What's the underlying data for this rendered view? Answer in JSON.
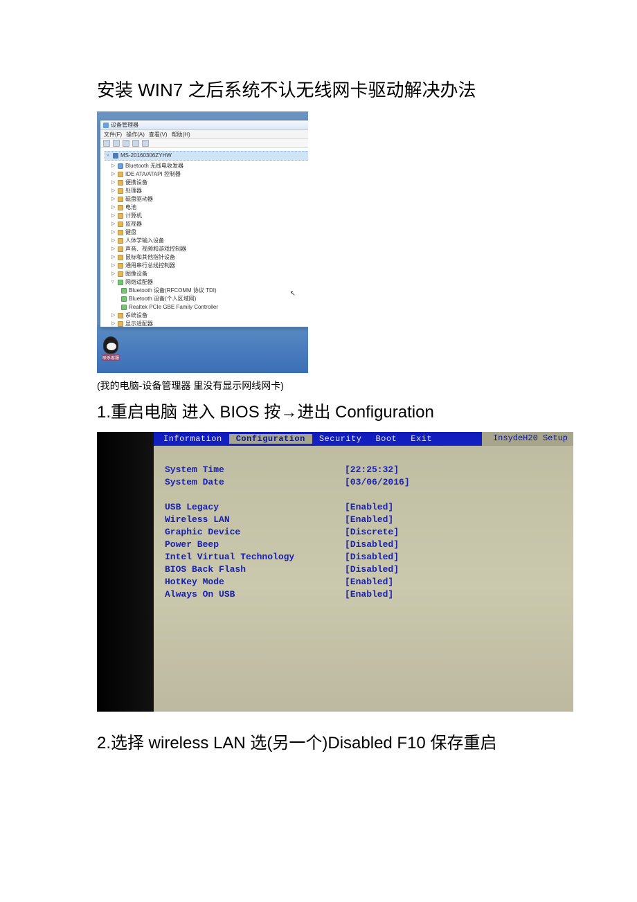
{
  "title": "安装 WIN7 之后系统不认无线网卡驱动解决办法",
  "deviceManager": {
    "windowTitle": "设备管理器",
    "menu": [
      "文件(F)",
      "操作(A)",
      "查看(V)",
      "帮助(H)"
    ],
    "root": "MS-20160306ZYHW",
    "nodes": [
      {
        "label": "Bluetooth 无线电收发器",
        "icon": "bt",
        "twisty": "▷"
      },
      {
        "label": "IDE ATA/ATAPI 控制器",
        "icon": "dev",
        "twisty": "▷"
      },
      {
        "label": "便携设备",
        "icon": "dev",
        "twisty": "▷"
      },
      {
        "label": "处理器",
        "icon": "dev",
        "twisty": "▷"
      },
      {
        "label": "磁盘驱动器",
        "icon": "dev",
        "twisty": "▷"
      },
      {
        "label": "电池",
        "icon": "dev",
        "twisty": "▷"
      },
      {
        "label": "计算机",
        "icon": "dev",
        "twisty": "▷"
      },
      {
        "label": "监视器",
        "icon": "dev",
        "twisty": "▷"
      },
      {
        "label": "键盘",
        "icon": "dev",
        "twisty": "▷"
      },
      {
        "label": "人体学输入设备",
        "icon": "dev",
        "twisty": "▷"
      },
      {
        "label": "声音、视频和游戏控制器",
        "icon": "dev",
        "twisty": "▷"
      },
      {
        "label": "鼠标和其他指针设备",
        "icon": "dev",
        "twisty": "▷"
      },
      {
        "label": "通用串行总线控制器",
        "icon": "dev",
        "twisty": "▷"
      },
      {
        "label": "图像设备",
        "icon": "dev",
        "twisty": "▷"
      },
      {
        "label": "网络适配器",
        "icon": "net",
        "twisty": "▿",
        "children": [
          {
            "label": "Bluetooth 设备(RFCOMM 协议 TDI)"
          },
          {
            "label": "Bluetooth 设备(个人区域网)"
          },
          {
            "label": "Realtek PCIe GBE Family Controller"
          }
        ]
      },
      {
        "label": "系统设备",
        "icon": "dev",
        "twisty": "▷"
      },
      {
        "label": "显示适配器",
        "icon": "dev",
        "twisty": "▷"
      }
    ],
    "qqLabel": "联系客服"
  },
  "caption": "(我的电脑-设备管理器  里没有显示网线网卡)",
  "step1": "1.重启电脑  进入 BIOS 按→进出 Configuration",
  "bios": {
    "brand": "InsydeH20 Setup",
    "tabs": [
      "Information",
      "Configuration",
      "Security",
      "Boot",
      "Exit"
    ],
    "selectedTab": "Configuration",
    "rows": [
      {
        "label": "System Time",
        "value": "[22:25:32]"
      },
      {
        "label": "System Date",
        "value": "[03/06/2016]"
      }
    ],
    "rows2": [
      {
        "label": "USB Legacy",
        "value": "[Enabled]"
      },
      {
        "label": "Wireless LAN",
        "value": "[Enabled]"
      },
      {
        "label": "Graphic Device",
        "value": "[Discrete]"
      },
      {
        "label": "Power Beep",
        "value": "[Disabled]"
      },
      {
        "label": "Intel Virtual Technology",
        "value": "[Disabled]"
      },
      {
        "label": "BIOS Back Flash",
        "value": "[Disabled]"
      },
      {
        "label": "HotKey Mode",
        "value": "[Enabled]"
      },
      {
        "label": "Always On USB",
        "value": "[Enabled]"
      }
    ]
  },
  "step2": "2.选择 wireless LAN  选(另一个)Disabled     F10 保存重启"
}
